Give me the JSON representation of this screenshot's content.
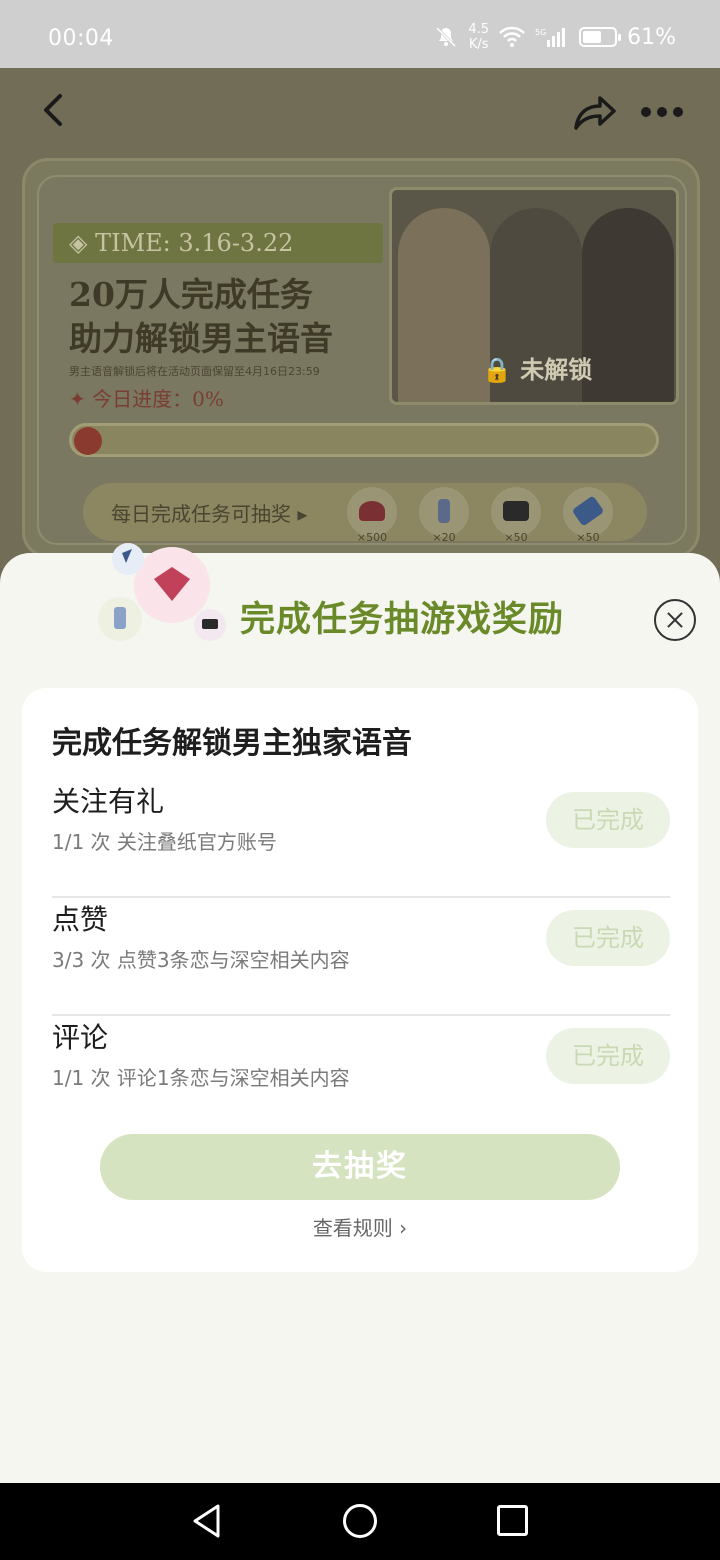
{
  "status_bar": {
    "time": "00:04",
    "net_speed_value": "4.5",
    "net_speed_unit": "K/s",
    "signal": "5G",
    "battery_percent": "61%",
    "battery_level": 0.61
  },
  "banner": {
    "time_tag": "◈ TIME: 3.16-3.22",
    "title_line1": "20万人完成任务",
    "title_line2": "助力解锁男主语音",
    "note": "男主语音解锁后将在活动页面保留至4月16日23:59",
    "progress_label": "✦ 今日进度：0%",
    "progress_value": 0,
    "poster_lock_label": "未解锁",
    "lottery_text": "每日完成任务可抽奖 ▸",
    "prizes": [
      {
        "name": "gem-icon",
        "qty": "×500",
        "color": "#7a2f33"
      },
      {
        "name": "potion-icon",
        "qty": "×20",
        "color": "#5b6a88"
      },
      {
        "name": "chest-icon",
        "qty": "×50",
        "color": "#2a2a2a"
      },
      {
        "name": "ticket-icon",
        "qty": "×50",
        "color": "#3c5a88"
      }
    ]
  },
  "sheet": {
    "title": "完成任务抽游戏奖励",
    "card_title": "完成任务解锁男主独家语音",
    "tasks": [
      {
        "name": "关注有礼",
        "desc": "1/1 次 关注叠纸官方账号",
        "status": "已完成"
      },
      {
        "name": "点赞",
        "desc": "3/3 次 点赞3条恋与深空相关内容",
        "status": "已完成"
      },
      {
        "name": "评论",
        "desc": "1/1 次 评论1条恋与深空相关内容",
        "status": "已完成"
      }
    ],
    "lottery_button": "去抽奖",
    "rules_link": "查看规则 ›"
  },
  "colors": {
    "accent_green": "#6a8a2a",
    "done_bg": "#edf3e4",
    "button_bg": "#d5e3c0"
  }
}
